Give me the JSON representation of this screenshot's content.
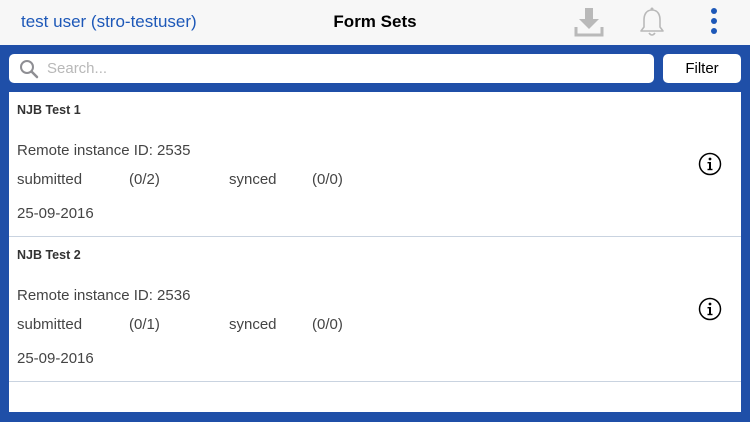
{
  "header": {
    "user": "test user (stro-testuser)",
    "title": "Form Sets",
    "icons": [
      "download-icon",
      "bell-icon",
      "more-vertical-icon"
    ]
  },
  "search": {
    "placeholder": "Search...",
    "value": ""
  },
  "filter_label": "Filter",
  "colors": {
    "accent": "#1f4fa8",
    "link": "#1d58b8",
    "header_bg": "#f7f7f7"
  },
  "form_sets": [
    {
      "name": "NJB Test 1",
      "remote": "Remote instance ID: 2535",
      "submitted_label": "submitted",
      "submitted_count": "(0/2)",
      "synced_label": "synced",
      "synced_count": "(0/0)",
      "date": "25-09-2016"
    },
    {
      "name": "NJB Test 2",
      "remote": "Remote instance ID: 2536",
      "submitted_label": "submitted",
      "submitted_count": "(0/1)",
      "synced_label": "synced",
      "synced_count": "(0/0)",
      "date": "25-09-2016"
    }
  ]
}
